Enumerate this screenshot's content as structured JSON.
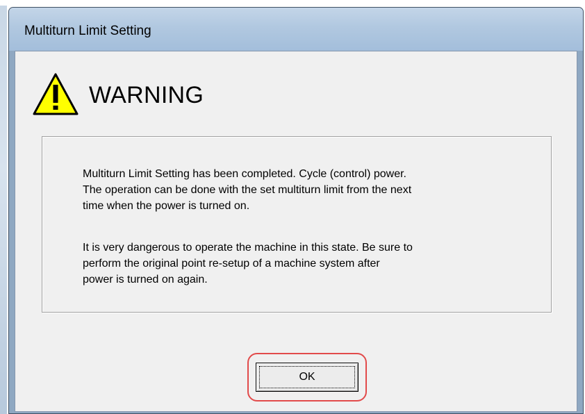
{
  "dialog": {
    "title": "Multiturn Limit Setting"
  },
  "warning": {
    "icon": "warning-triangle-icon",
    "icon_color": "#ffff00",
    "title": "WARNING"
  },
  "message": {
    "paragraph1": [
      "Multiturn Limit Setting has been completed. Cycle (control) power.",
      "The operation can be done with the set multiturn limit from the next",
      "time when the power is turned on."
    ],
    "paragraph2": [
      "It is very dangerous to operate the machine in this state. Be sure to",
      "perform the original point re-setup of a machine system after",
      "power is turned on again."
    ]
  },
  "buttons": {
    "ok_label": "OK",
    "highlight_color": "#e24a4a"
  }
}
